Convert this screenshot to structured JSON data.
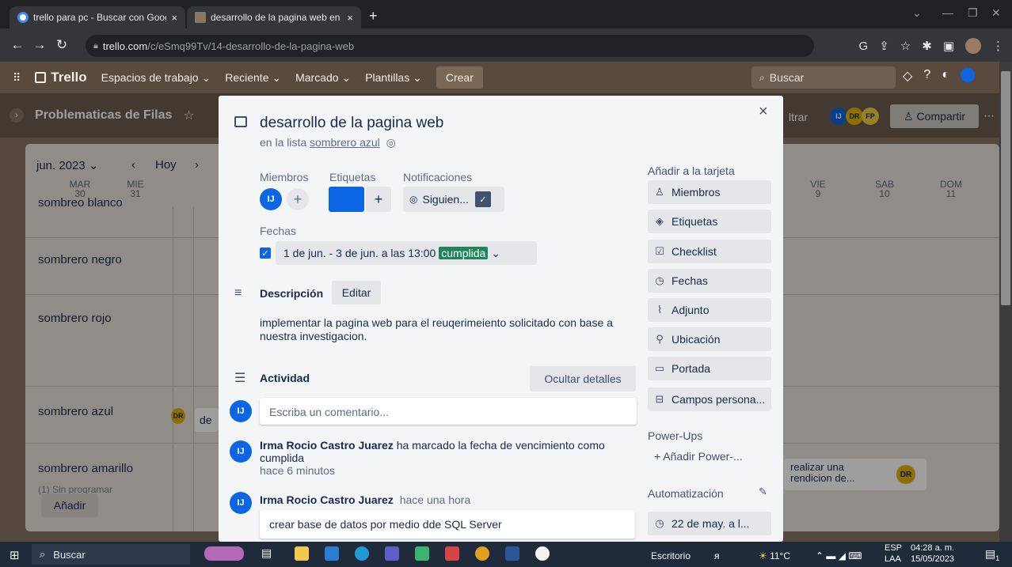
{
  "browser": {
    "tabs": [
      {
        "title": "trello para pc - Buscar con Googl",
        "close": "×"
      },
      {
        "title": "desarrollo de la pagina web en P",
        "close": "×"
      }
    ],
    "new_tab": "+",
    "url_host": "trello.com",
    "url_path": "/c/eSmq99Tv/14-desarrollo-de-la-pagina-web"
  },
  "trello_header": {
    "logo": "Trello",
    "menus": [
      "Espacios de trabajo ⌄",
      "Reciente ⌄",
      "Marcado ⌄",
      "Plantillas ⌄"
    ],
    "create": "Crear",
    "search_placeholder": "Buscar"
  },
  "board": {
    "title": "Problematicas de Filas",
    "filter_fragment": "ltrar",
    "members": [
      "IJ",
      "DR",
      "FP"
    ],
    "share": "Compartir",
    "month_selector": "jun. 2023 ⌄",
    "today": "Hoy",
    "days": [
      {
        "name": "MAR",
        "num": "30"
      },
      {
        "name": "MIE",
        "num": "31"
      },
      {
        "name": "VIE",
        "num": "9"
      },
      {
        "name": "SAB",
        "num": "10"
      },
      {
        "name": "DOM",
        "num": "11"
      }
    ],
    "rows": [
      "sombreo blanco",
      "sombrero negro",
      "sombrero rojo",
      "sombrero azul",
      "sombrero amarillo"
    ],
    "unscheduled": "(1) Sin programar",
    "add": "Añadir",
    "card_fragment": "de",
    "card_right": "realizar una rendicion de...",
    "card_right_member": "DR"
  },
  "card": {
    "title": "desarrollo de la  pagina  web",
    "in_list_prefix": "en la lista",
    "list_name": "sombrero azul",
    "members_label": "Miembros",
    "labels_label": "Etiquetas",
    "notifications_label": "Notificaciones",
    "member_initials": "IJ",
    "plus": "+",
    "watch_text": "Siguien...",
    "dates_label": "Fechas",
    "date_text": "1 de jun. - 3 de jun. a las 13:00",
    "date_status": "cumplida",
    "description_label": "Descripción",
    "edit": "Editar",
    "description": "implementar la pagina web para el reuqerimeiento solicitado con base a nuestra investigacion.",
    "activity_label": "Actividad",
    "hide_details": "Ocultar detalles",
    "comment_placeholder": "Escriba un comentario...",
    "activities": [
      {
        "author": "Irma Rocio Castro Juarez",
        "text": "ha marcado la fecha de vencimiento como cumplida",
        "time": "hace 6 minutos"
      },
      {
        "author": "Irma Rocio Castro Juarez",
        "text": "",
        "time": "hace una hora",
        "comment": "crear base de datos por medio dde SQL Server"
      }
    ]
  },
  "sidebar": {
    "add_to_card": "Añadir a la tarjeta",
    "buttons": [
      "Miembros",
      "Etiquetas",
      "Checklist",
      "Fechas",
      "Adjunto",
      "Ubicación",
      "Portada",
      "Campos persona..."
    ],
    "powerups_label": "Power-Ups",
    "add_powerup": "Añadir Power-...",
    "automation_label": "Automatización",
    "automation_item": "22 de may. a l..."
  },
  "taskbar": {
    "search": "Buscar",
    "desktop": "Escritorio",
    "temp": "11°C",
    "lang": "ESP",
    "lang2": "LAA",
    "time": "04:28 a. m.",
    "date": "15/05/2023",
    "notif": "1"
  }
}
